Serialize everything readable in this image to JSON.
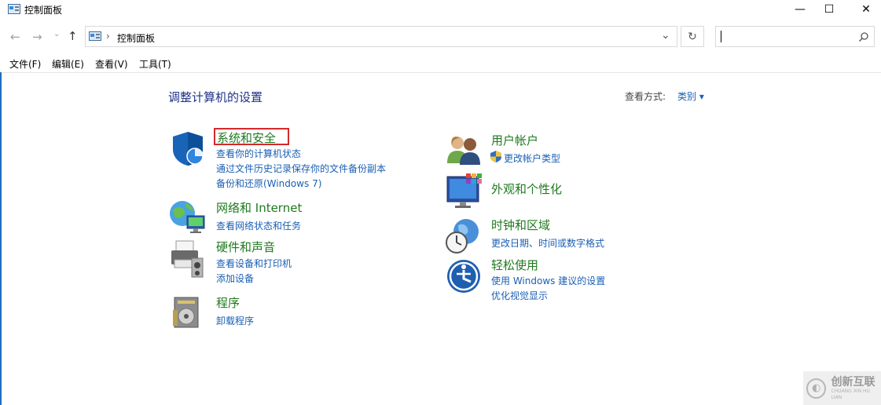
{
  "window": {
    "title": "控制面板",
    "minimize": "—",
    "maximize": "☐",
    "close": "✕"
  },
  "address": {
    "path_root": "控制面板",
    "separator": "›",
    "dropdown": "⌄",
    "refresh": "↻",
    "search_placeholder": ""
  },
  "menu": {
    "file": "文件(F)",
    "edit": "编辑(E)",
    "view": "查看(V)",
    "tools": "工具(T)"
  },
  "content": {
    "heading": "调整计算机的设置",
    "view_by_label": "查看方式:",
    "view_by_value": "类别 ▾"
  },
  "categories": {
    "system_security": {
      "title": "系统和安全",
      "links": [
        "查看你的计算机状态",
        "通过文件历史记录保存你的文件备份副本",
        "备份和还原(Windows 7)"
      ]
    },
    "network": {
      "title": "网络和 Internet",
      "links": [
        "查看网络状态和任务"
      ]
    },
    "hardware": {
      "title": "硬件和声音",
      "links": [
        "查看设备和打印机",
        "添加设备"
      ]
    },
    "programs": {
      "title": "程序",
      "links": [
        "卸载程序"
      ]
    },
    "user_accounts": {
      "title": "用户帐户",
      "links": [
        "更改帐户类型"
      ]
    },
    "appearance": {
      "title": "外观和个性化",
      "links": []
    },
    "clock_region": {
      "title": "时钟和区域",
      "links": [
        "更改日期、时间或数字格式"
      ]
    },
    "ease_access": {
      "title": "轻松使用",
      "links": [
        "使用 Windows 建议的设置",
        "优化视觉显示"
      ]
    }
  },
  "watermark": {
    "text": "创新互联",
    "sub": "CHUANG XIN HU LIAN"
  },
  "colors": {
    "category_title": "#1e7a1e",
    "link": "#1a5fb4",
    "heading": "#1e3287",
    "highlight_box": "#d42a2a"
  }
}
